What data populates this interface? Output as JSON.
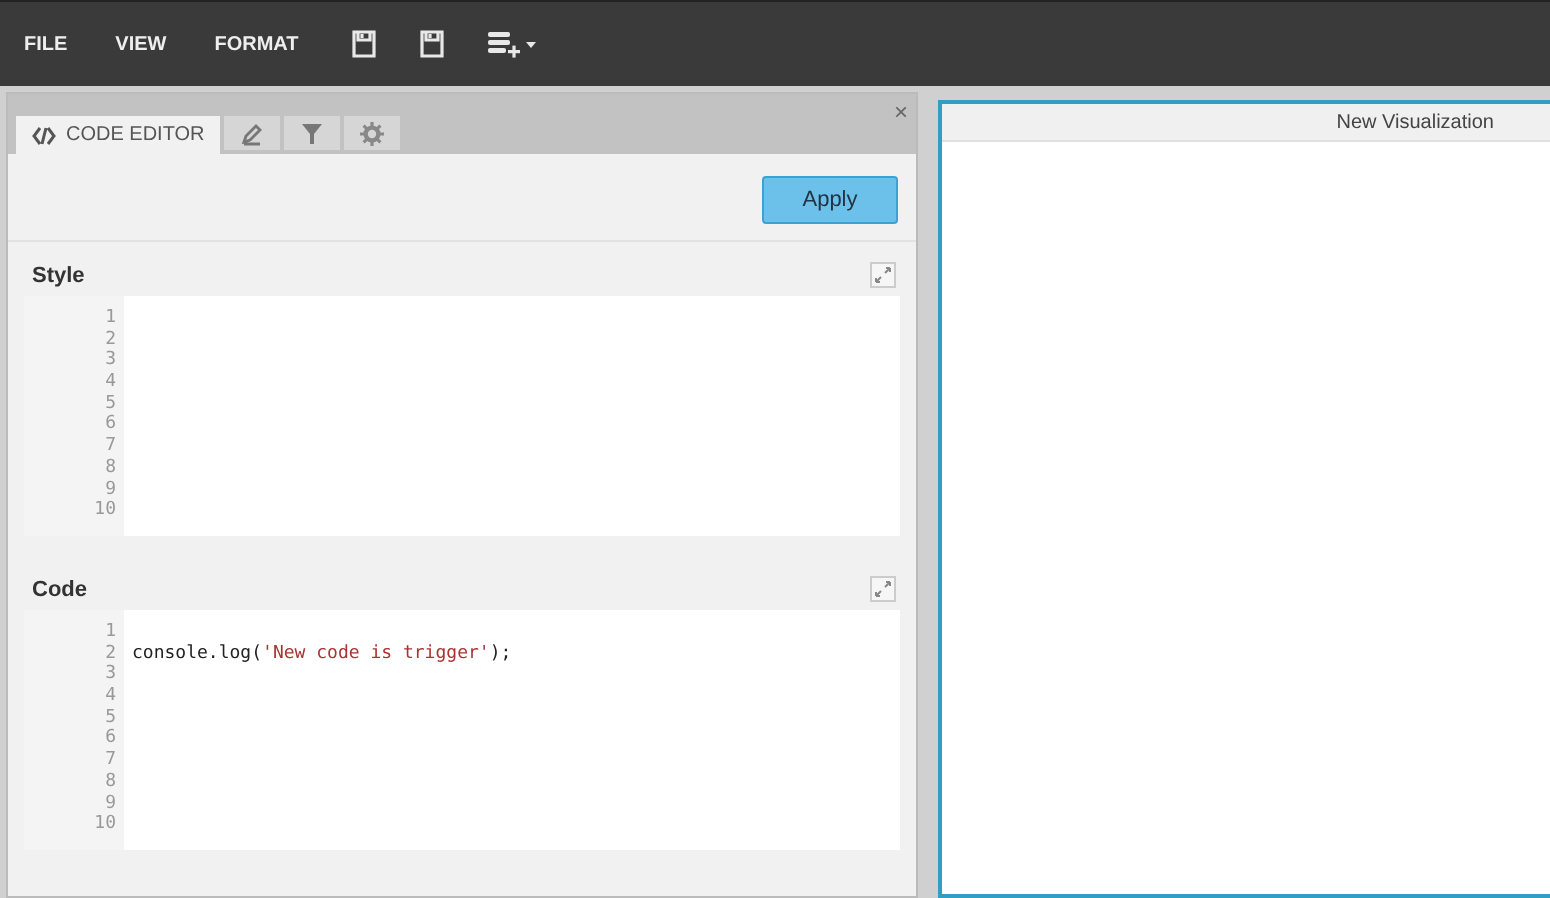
{
  "menu": [
    {
      "label": "FILE"
    },
    {
      "label": "VIEW"
    },
    {
      "label": "FORMAT"
    }
  ],
  "toolbar": [
    {
      "kind": "save"
    },
    {
      "kind": "save"
    },
    {
      "kind": "data-add"
    }
  ],
  "tabs": [
    {
      "kind": "code",
      "label": "CODE EDITOR",
      "selected": true
    },
    {
      "kind": "pencil",
      "selected": false
    },
    {
      "kind": "filter",
      "selected": false
    },
    {
      "kind": "gear",
      "selected": false
    }
  ],
  "close": "×",
  "apply_button": "Apply",
  "editors": [
    {
      "title": "Style",
      "lines": [
        {
          "number": "1"
        },
        {
          "number": "2"
        },
        {
          "number": "3"
        },
        {
          "number": "4"
        },
        {
          "number": "5"
        },
        {
          "number": "6"
        },
        {
          "number": "7"
        },
        {
          "number": "8"
        },
        {
          "number": "9"
        },
        {
          "number": "10"
        }
      ]
    },
    {
      "title": "Code",
      "lines": [
        {
          "number": "1"
        },
        {
          "number": "2",
          "code": [
            {
              "text": "console.log(",
              "kind": "plain"
            },
            {
              "text": "'New code is trigger'",
              "kind": "string"
            },
            {
              "text": ");",
              "kind": "plain"
            }
          ]
        },
        {
          "number": "3"
        },
        {
          "number": "4"
        },
        {
          "number": "5"
        },
        {
          "number": "6"
        },
        {
          "number": "7"
        },
        {
          "number": "8"
        },
        {
          "number": "9"
        },
        {
          "number": "10"
        }
      ]
    }
  ],
  "visualization": {
    "title": "New Visualization"
  }
}
